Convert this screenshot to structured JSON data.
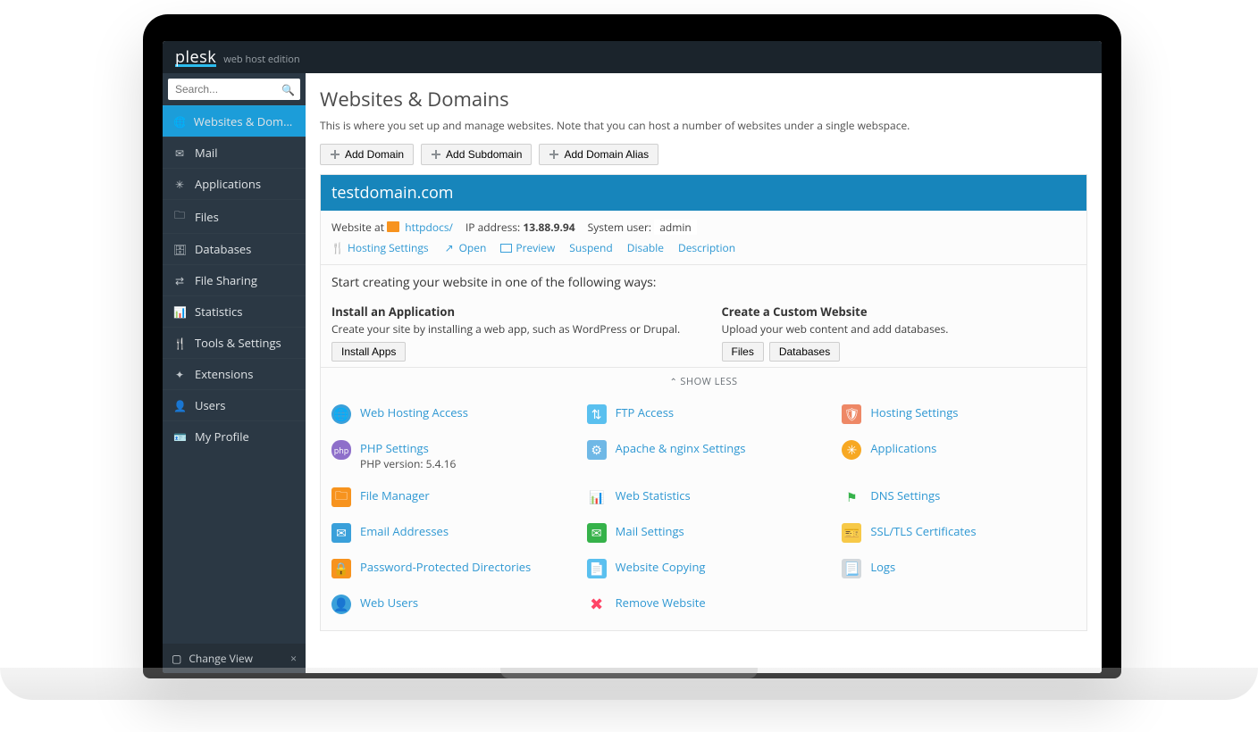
{
  "brand": {
    "name": "plesk",
    "edition": "web host edition"
  },
  "search": {
    "placeholder": "Search..."
  },
  "sidebar": {
    "items": [
      {
        "icon": "globe-icon",
        "glyph": "🌐",
        "label": "Websites & Domains",
        "active": true
      },
      {
        "icon": "mail-icon",
        "glyph": "✉",
        "label": "Mail"
      },
      {
        "icon": "gear-icon",
        "glyph": "✳",
        "label": "Applications"
      },
      {
        "icon": "folder-icon",
        "glyph": "🗀",
        "label": "Files"
      },
      {
        "icon": "database-icon",
        "glyph": "🗄",
        "label": "Databases"
      },
      {
        "icon": "share-icon",
        "glyph": "⇄",
        "label": "File Sharing"
      },
      {
        "icon": "bars-icon",
        "glyph": "📊",
        "label": "Statistics"
      },
      {
        "icon": "fork-icon",
        "glyph": "🍴",
        "label": "Tools & Settings"
      },
      {
        "icon": "puzzle-icon",
        "glyph": "✦",
        "label": "Extensions"
      },
      {
        "icon": "user-icon",
        "glyph": "👤",
        "label": "Users"
      },
      {
        "icon": "id-icon",
        "glyph": "🪪",
        "label": "My Profile"
      }
    ],
    "footer": {
      "icon": "layout-icon",
      "label": "Change View",
      "close": "×"
    }
  },
  "page": {
    "title": "Websites & Domains",
    "subtitle": "This is where you set up and manage websites. Note that you can host a number of websites under a single webspace."
  },
  "toolbar": {
    "add_domain": "Add Domain",
    "add_subdomain": "Add Subdomain",
    "add_alias": "Add Domain Alias"
  },
  "domain": {
    "name": "testdomain.com",
    "meta": {
      "website_at": "Website at",
      "httpdocs": "httpdocs/",
      "ip_label": "IP address:",
      "ip": "13.88.9.94",
      "sysuser_label": "System user:",
      "sysuser": "admin"
    },
    "actions": {
      "hosting": "Hosting Settings",
      "open": "Open",
      "preview": "Preview",
      "suspend": "Suspend",
      "disable": "Disable",
      "description": "Description"
    },
    "intro": "Start creating your website in one of the following ways:",
    "install_block": {
      "title": "Install an Application",
      "desc": "Create your site by installing a web app, such as WordPress or Drupal.",
      "btn": "Install Apps"
    },
    "custom_block": {
      "title": "Create a Custom Website",
      "desc": "Upload your web content and add databases.",
      "files_btn": "Files",
      "db_btn": "Databases"
    },
    "show_less": "SHOW LESS",
    "tiles": [
      {
        "icon": "globe",
        "label": "Web Hosting Access"
      },
      {
        "icon": "ftp",
        "label": "FTP Access"
      },
      {
        "icon": "shield",
        "label": "Hosting Settings"
      },
      {
        "icon": "php",
        "label": "PHP Settings",
        "sub": "PHP version: 5.4.16"
      },
      {
        "icon": "apache",
        "label": "Apache & nginx Settings"
      },
      {
        "icon": "appgear",
        "label": "Applications"
      },
      {
        "icon": "folder",
        "label": "File Manager"
      },
      {
        "icon": "stats",
        "label": "Web Statistics"
      },
      {
        "icon": "dns",
        "label": "DNS Settings"
      },
      {
        "icon": "mail",
        "label": "Email Addresses"
      },
      {
        "icon": "mailcfg",
        "label": "Mail Settings"
      },
      {
        "icon": "ssl",
        "label": "SSL/TLS Certificates"
      },
      {
        "icon": "lock",
        "label": "Password-Protected Directories"
      },
      {
        "icon": "copy",
        "label": "Website Copying"
      },
      {
        "icon": "logs",
        "label": "Logs"
      },
      {
        "icon": "users",
        "label": "Web Users"
      },
      {
        "icon": "remove",
        "label": "Remove Website"
      }
    ]
  }
}
